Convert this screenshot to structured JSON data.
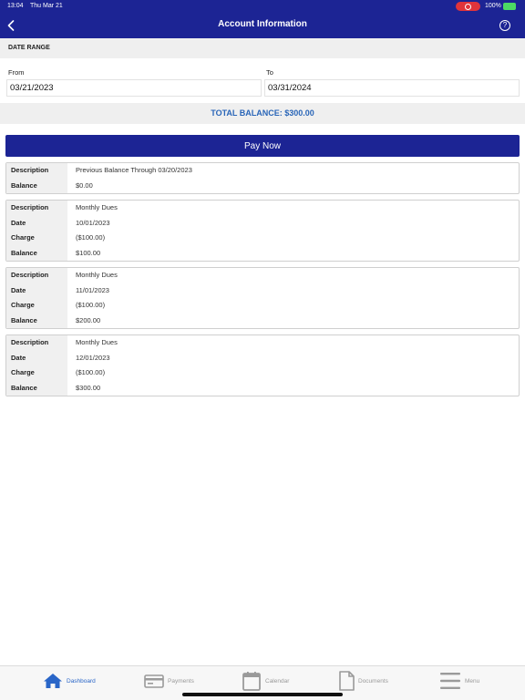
{
  "status_bar": {
    "time": "13:04",
    "date": "Thu Mar 21",
    "battery": "100%"
  },
  "header": {
    "title": "Account Information"
  },
  "date_range": {
    "section_title": "DATE RANGE",
    "from_label": "From",
    "from_value": "03/21/2023",
    "to_label": "To",
    "to_value": "03/31/2024"
  },
  "total_balance": "TOTAL BALANCE: $300.00",
  "pay_now_label": "Pay Now",
  "transactions": [
    {
      "rows": [
        {
          "label": "Description",
          "value": "Previous Balance Through 03/20/2023"
        },
        {
          "label": "Balance",
          "value": "$0.00"
        }
      ]
    },
    {
      "rows": [
        {
          "label": "Description",
          "value": "Monthly Dues"
        },
        {
          "label": "Date",
          "value": "10/01/2023"
        },
        {
          "label": "Charge",
          "value": "($100.00)"
        },
        {
          "label": "Balance",
          "value": "$100.00"
        }
      ]
    },
    {
      "rows": [
        {
          "label": "Description",
          "value": "Monthly Dues"
        },
        {
          "label": "Date",
          "value": "11/01/2023"
        },
        {
          "label": "Charge",
          "value": "($100.00)"
        },
        {
          "label": "Balance",
          "value": "$200.00"
        }
      ]
    },
    {
      "rows": [
        {
          "label": "Description",
          "value": "Monthly Dues"
        },
        {
          "label": "Date",
          "value": "12/01/2023"
        },
        {
          "label": "Charge",
          "value": "($100.00)"
        },
        {
          "label": "Balance",
          "value": "$300.00"
        }
      ]
    }
  ],
  "tabs": [
    {
      "label": "Dashboard",
      "icon": "home-icon",
      "active": true
    },
    {
      "label": "Payments",
      "icon": "card-icon",
      "active": false
    },
    {
      "label": "Calendar",
      "icon": "calendar-icon",
      "active": false
    },
    {
      "label": "Documents",
      "icon": "document-icon",
      "active": false
    },
    {
      "label": "Menu",
      "icon": "menu-icon",
      "active": false
    }
  ],
  "colors": {
    "primary": "#1c2494",
    "accent": "#2a66b8",
    "tab_active": "#2a66c8",
    "tab_inactive": "#9a9a9a"
  }
}
